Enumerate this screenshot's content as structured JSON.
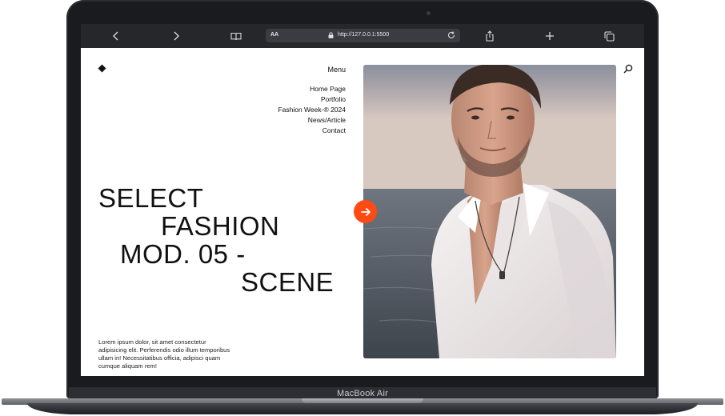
{
  "device": {
    "label": "MacBook Air"
  },
  "browser": {
    "url_prefix": "AA",
    "url": "http://127.0.0.1:5500",
    "icons": [
      "chevron-left-icon",
      "chevron-right-icon",
      "book-icon",
      "lock-icon",
      "reload-icon",
      "share-icon",
      "plus-icon",
      "tabs-icon"
    ]
  },
  "site": {
    "menu_title": "Menu",
    "menu_items": [
      "Home Page",
      "Portfolio",
      "Fashion Week-® 2024",
      "News/Article",
      "Contact"
    ],
    "hero_lines": [
      "SELECT",
      "FASHION",
      "MOD. 05 -",
      "SCENE"
    ],
    "paragraph": "Lorem ipsum dolor, sit amet consectetur adipisicing elit. Perferendis odio illum temporibus ullam in! Necessitatibus officia, adipisci quam cumque aliquam rem!",
    "accent_color": "#ff4a12"
  }
}
